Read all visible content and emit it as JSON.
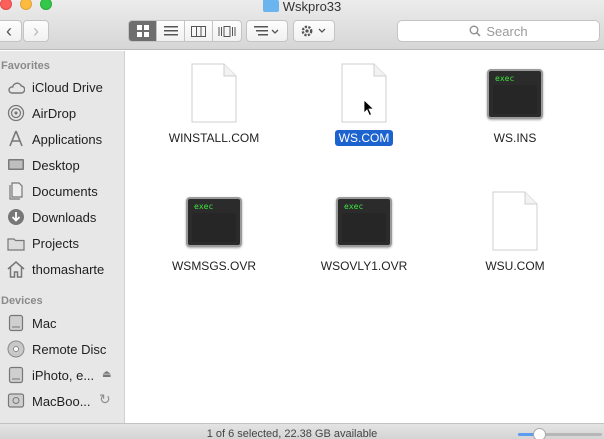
{
  "window": {
    "title": "Wskpro33"
  },
  "toolbar": {
    "back_glyph": "‹",
    "forward_glyph": "›",
    "search_placeholder": "Search",
    "icons": {
      "back": "chevron-left-icon",
      "forward": "chevron-right-icon",
      "icon_view": "grid-icon",
      "list_view": "list-icon",
      "column_view": "columns-icon",
      "cover_flow": "coverflow-icon",
      "arrange": "arrange-icon",
      "action": "gear-icon",
      "search": "magnifier-icon"
    }
  },
  "sidebar": {
    "favorites_header": "Favorites",
    "favorites": [
      {
        "label": "iCloud Drive",
        "icon": "cloud-icon"
      },
      {
        "label": "AirDrop",
        "icon": "airdrop-icon"
      },
      {
        "label": "Applications",
        "icon": "applications-icon"
      },
      {
        "label": "Desktop",
        "icon": "desktop-icon"
      },
      {
        "label": "Documents",
        "icon": "documents-icon"
      },
      {
        "label": "Downloads",
        "icon": "downloads-icon"
      },
      {
        "label": "Projects",
        "icon": "folder-icon"
      },
      {
        "label": "thomasharte",
        "icon": "home-icon"
      }
    ],
    "devices_header": "Devices",
    "devices": [
      {
        "label": "Mac",
        "icon": "drive-icon"
      },
      {
        "label": "Remote Disc",
        "icon": "disc-icon"
      },
      {
        "label": "iPhoto, e...",
        "icon": "drive-icon",
        "badge": "eject-icon"
      },
      {
        "label": "MacBoo...",
        "icon": "timemachine-icon",
        "badge": "sync-icon"
      }
    ],
    "eject_glyph": "⏏",
    "sync_glyph": "↻"
  },
  "files": [
    {
      "name": "WINSTALL.COM",
      "kind": "document",
      "selected": false
    },
    {
      "name": "WS.COM",
      "kind": "document",
      "selected": true
    },
    {
      "name": "WS.INS",
      "kind": "exec",
      "selected": false
    },
    {
      "name": "WSMSGS.OVR",
      "kind": "exec",
      "selected": false
    },
    {
      "name": "WSOVLY1.OVR",
      "kind": "exec",
      "selected": false
    },
    {
      "name": "WSU.COM",
      "kind": "document",
      "selected": false
    }
  ],
  "exec_label": "exec",
  "status": {
    "text": "1 of 6 selected, 22.38 GB available",
    "zoom_level": 0.25
  },
  "colors": {
    "selection": "#1d63d0",
    "accent": "#5b9bf0",
    "folder": "#6ab4f0"
  }
}
